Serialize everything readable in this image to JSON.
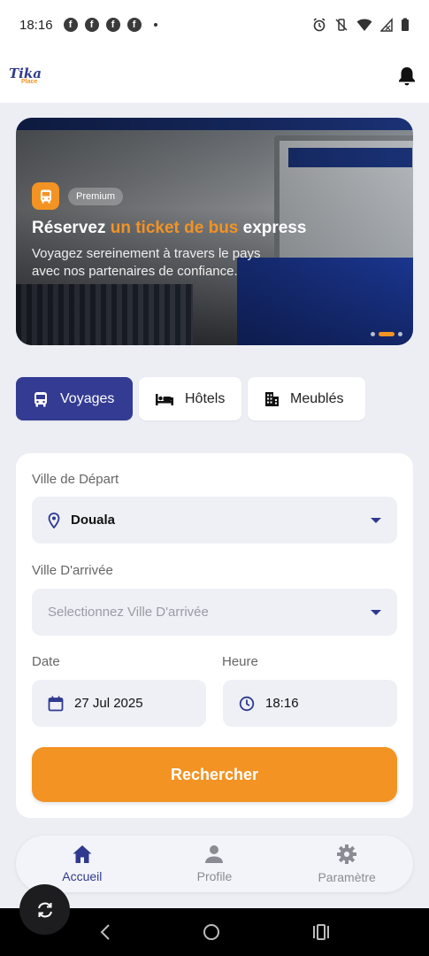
{
  "status_bar": {
    "time": "18:16"
  },
  "app_bar": {
    "logo_line1": "Tika",
    "logo_line2": "Place"
  },
  "banner": {
    "badge": "Premium",
    "headline_part1": "Réservez ",
    "headline_highlight": "un ticket de bus",
    "headline_part2": " express",
    "subtitle_line1": "Voyagez sereinement à travers le pays",
    "subtitle_line2": "avec nos partenaires de confiance.",
    "carousel_count": 3,
    "carousel_active_index": 1
  },
  "tabs": [
    {
      "label": "Voyages",
      "icon": "bus-icon",
      "active": true
    },
    {
      "label": "Hôtels",
      "icon": "bed-icon",
      "active": false
    },
    {
      "label": "Meublés",
      "icon": "building-icon",
      "active": false
    }
  ],
  "form": {
    "departure_label": "Ville de Départ",
    "departure_value": "Douala",
    "arrival_label": "Ville D'arrivée",
    "arrival_placeholder": "Selectionnez Ville D'arrivée",
    "date_label": "Date",
    "date_value": "27 Jul 2025",
    "time_label": "Heure",
    "time_value": "18:16",
    "search_button": "Rechercher"
  },
  "bottom_nav": [
    {
      "label": "Accueil",
      "icon": "home-icon",
      "active": true
    },
    {
      "label": "Profile",
      "icon": "person-icon",
      "active": false
    },
    {
      "label": "Paramètre",
      "icon": "gear-icon",
      "active": false
    }
  ],
  "colors": {
    "primary": "#333b92",
    "accent": "#f39323",
    "background": "#eceef4"
  }
}
